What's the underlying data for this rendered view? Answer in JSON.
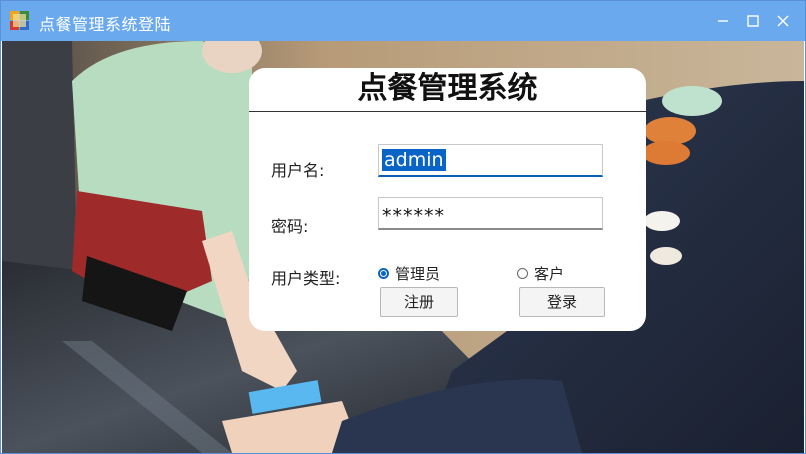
{
  "window": {
    "title": "点餐管理系统登陆"
  },
  "login": {
    "heading": "点餐管理系统",
    "username_label": "用户名:",
    "username_value": "admin",
    "password_label": "密码:",
    "password_value": "******",
    "usertype_label": "用户类型:",
    "radio_admin": "管理员",
    "radio_customer": "客户",
    "register_button": "注册",
    "login_button": "登录"
  },
  "colors": {
    "titlebar": "#6aa9ee",
    "accent": "#0a64c8"
  }
}
